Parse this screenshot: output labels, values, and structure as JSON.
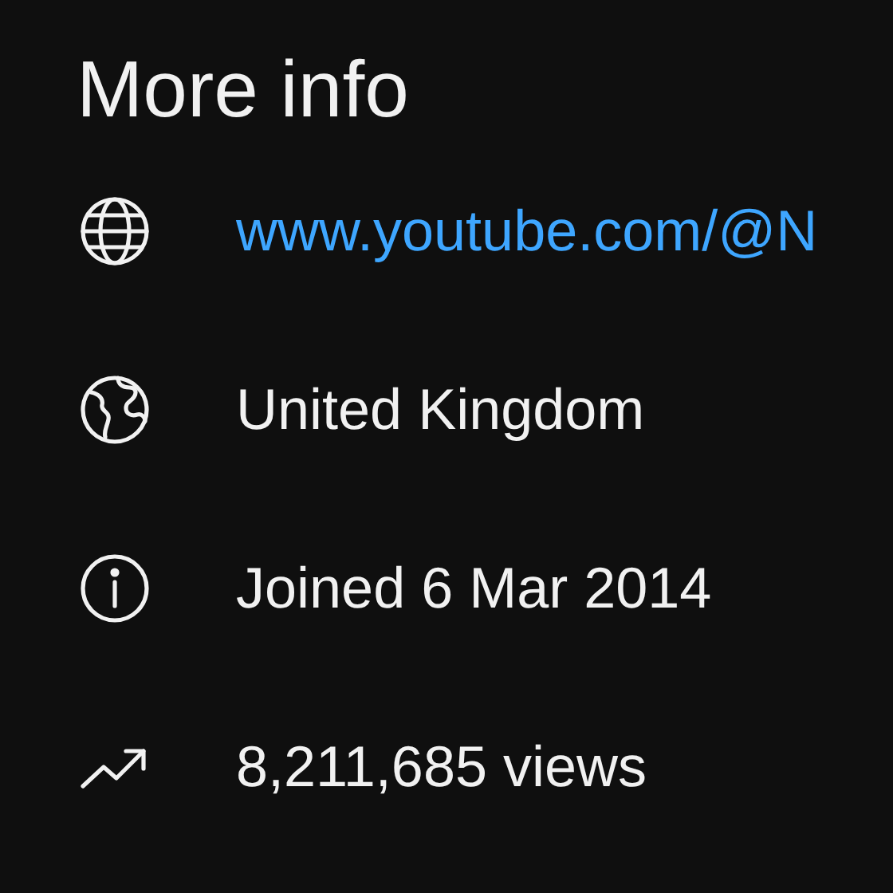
{
  "title": "More info",
  "items": [
    {
      "kind": "link",
      "text": "www.youtube.com/@N"
    },
    {
      "kind": "location",
      "text": "United Kingdom"
    },
    {
      "kind": "info",
      "text": "Joined 6 Mar 2014"
    },
    {
      "kind": "views",
      "text": "8,211,685 views"
    }
  ]
}
